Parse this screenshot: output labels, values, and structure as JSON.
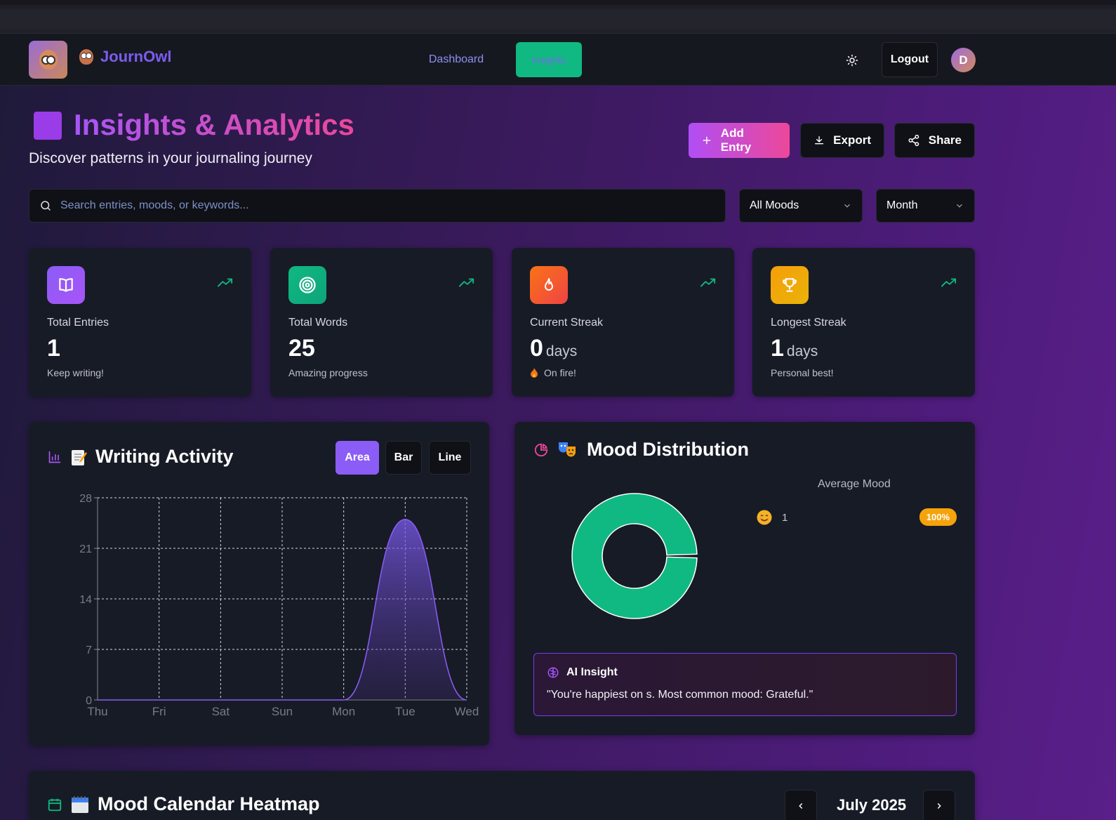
{
  "app": {
    "brand": "JournOwl",
    "nav": {
      "dashboard": "Dashboard",
      "insights": "Insights"
    },
    "logout": "Logout",
    "avatar_initial": "D"
  },
  "header": {
    "title": "Insights & Analytics",
    "subtitle": "Discover patterns in your journaling journey",
    "add_entry": "Add Entry",
    "export": "Export",
    "share": "Share"
  },
  "filters": {
    "search_placeholder": "Search entries, moods, or keywords...",
    "mood_filter": "All Moods",
    "period_filter": "Month"
  },
  "stats": [
    {
      "label": "Total Entries",
      "value": "1",
      "unit": "",
      "note": "Keep writing!",
      "icon": "book-icon",
      "color": "#8b5cf6"
    },
    {
      "label": "Total Words",
      "value": "25",
      "unit": "",
      "note": "Amazing progress",
      "icon": "target-icon",
      "color": "#10b981"
    },
    {
      "label": "Current Streak",
      "value": "0",
      "unit": "days",
      "note": "On fire!",
      "icon": "flame-icon",
      "color": "#f97316"
    },
    {
      "label": "Longest Streak",
      "value": "1",
      "unit": "days",
      "note": "Personal best!",
      "icon": "trophy-icon",
      "color": "#f59e0b"
    }
  ],
  "writing_activity": {
    "title": "Writing Activity",
    "chart_types": [
      "Area",
      "Bar",
      "Line"
    ],
    "active_type": "Area"
  },
  "chart_data": {
    "type": "area",
    "categories": [
      "Thu",
      "Fri",
      "Sat",
      "Sun",
      "Mon",
      "Tue",
      "Wed"
    ],
    "values": [
      0,
      0,
      0,
      0,
      0,
      25,
      0
    ],
    "ylim": [
      0,
      28
    ],
    "yticks": [
      0,
      7,
      14,
      21,
      28
    ],
    "grid": true,
    "color": "#8b5cf6"
  },
  "mood_distribution": {
    "title": "Mood Distribution",
    "average_label": "Average Mood",
    "items": [
      {
        "emoji": "😊",
        "count": "1",
        "percent": "100%",
        "color": "#10b981"
      }
    ],
    "insight_title": "AI Insight",
    "insight_text": "\"You're happiest on s. Most common mood: Grateful.\""
  },
  "heatmap": {
    "title": "Mood Calendar Heatmap",
    "month": "July 2025"
  }
}
